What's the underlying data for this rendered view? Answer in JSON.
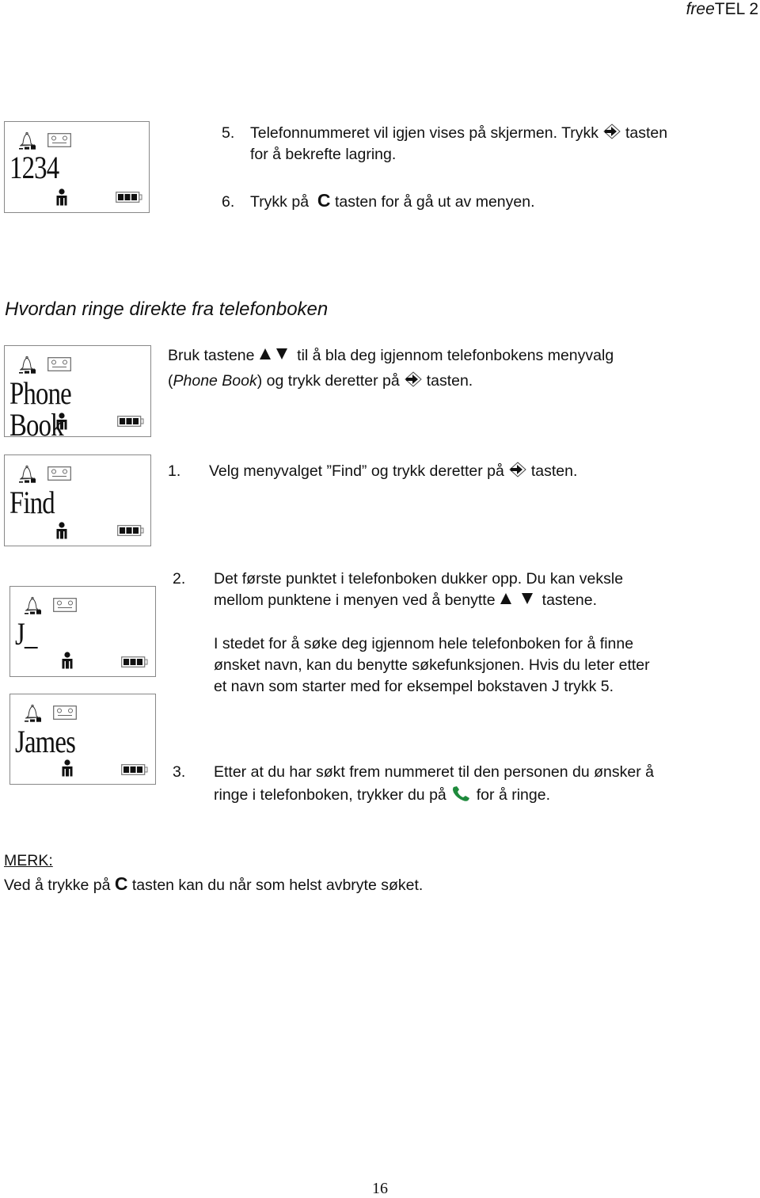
{
  "header": {
    "brand_italic": "free",
    "brand_rest": "TEL 2"
  },
  "section1": {
    "lcd": {
      "display": "1234"
    },
    "step5": {
      "num": "5.",
      "line1_a": "Telefonnummeret vil igjen vises på skjermen. Trykk",
      "line1_b": "tasten",
      "line2": "for å bekrefte lagring."
    },
    "step6": {
      "num": "6.",
      "a": "Trykk på",
      "key": "C",
      "b": "tasten for å gå ut av menyen."
    }
  },
  "heading": "Hvordan ringe direkte fra telefonboken",
  "section2": {
    "lcd": {
      "display": "Phone Book"
    },
    "line1_a": "Bruk tastene",
    "line1_b": "til å bla deg igjennom telefonbokens menyvalg",
    "line2_open": "(",
    "line2_italic": "Phone Book",
    "line2_a": ") og trykk deretter på",
    "line2_b": "tasten."
  },
  "section3": {
    "lcd": {
      "display": "Find"
    },
    "num": "1.",
    "a": "Velg menyvalget ”Find” og trykk deretter på",
    "b": "tasten."
  },
  "section4": {
    "lcd_j": {
      "display": "J_"
    },
    "lcd_james": {
      "display": "James"
    },
    "step2": {
      "num": "2.",
      "line1": "Det første punktet i telefonboken dukker opp. Du kan veksle",
      "line2_a": "mellom punktene i menyen ved å benytte",
      "line2_b": "tastene."
    },
    "para": [
      "I stedet for å søke deg igjennom hele telefonboken for å finne",
      "ønsket navn, kan du benytte søkefunksjonen. Hvis du leter etter",
      "et navn som starter med for eksempel bokstaven J  trykk 5."
    ],
    "step3": {
      "num": "3.",
      "line1": "Etter at du har søkt frem nummeret til den personen du ønsker å",
      "line2_a": "ringe i telefonboken, trykker du på",
      "line2_b": "for å ringe."
    }
  },
  "note": {
    "title": "MERK:",
    "a": "Ved å trykke på",
    "key": "C",
    "b": "tasten kan du når som helst avbryte søket."
  },
  "icons": {
    "lcd_icons": [
      "bell-icon",
      "signal-bars-icon",
      "tape-icon",
      "person-icon",
      "battery-icon"
    ],
    "inline_icons": [
      "ok-arrow-key-icon",
      "up-triangle-icon",
      "down-triangle-icon",
      "green-phone-icon"
    ],
    "phone_green": "#1e8a3c"
  },
  "page_number": "16"
}
